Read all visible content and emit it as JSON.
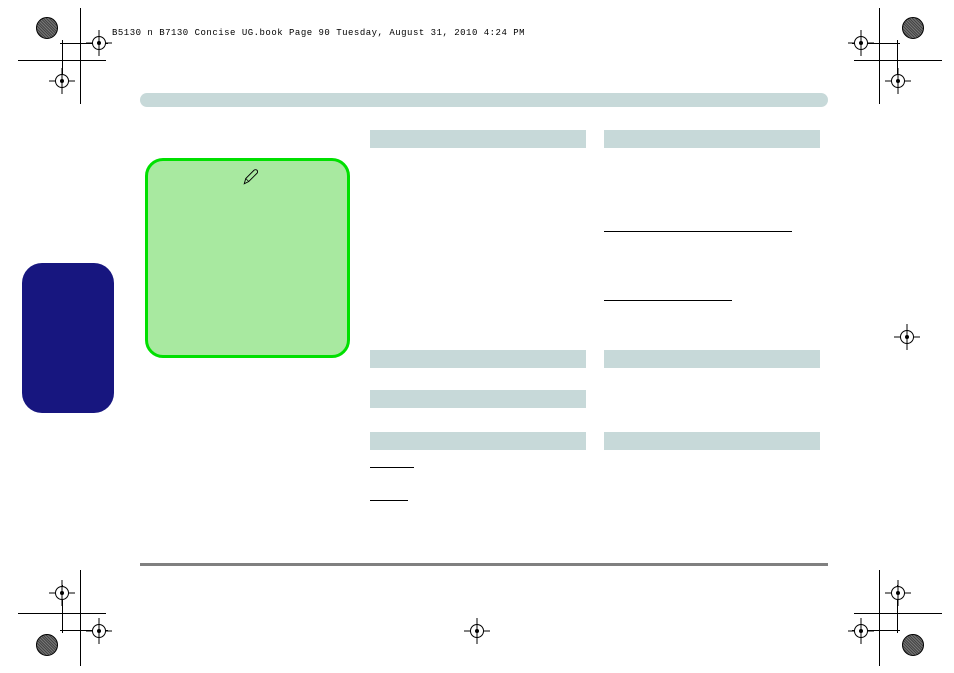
{
  "header": {
    "source_line": "B5130 n B7130 Concise UG.book  Page 90  Tuesday, August 31, 2010  4:24 PM"
  },
  "marks": {
    "reg": "registration-mark",
    "texture": "halftone-circle",
    "pen": "pen-icon"
  }
}
